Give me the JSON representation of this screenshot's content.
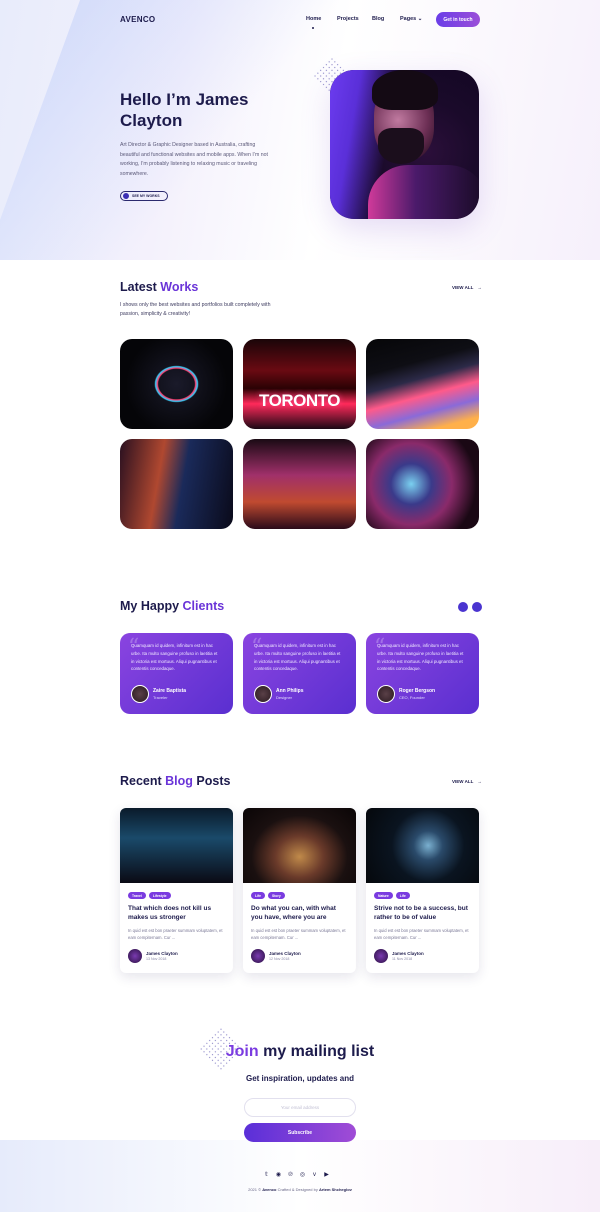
{
  "brand": "AVENCO",
  "nav": {
    "home": "Home",
    "projects": "Projects",
    "blog": "Blog",
    "pages": "Pages ⌄",
    "cta": "Get in touch"
  },
  "hero": {
    "title": "Hello I’m James Clayton",
    "text": "Art Director & Graphic Designer based in Australia, crafting beautiful and functional websites and mobile apps. When I’m not working, I’m probably listening to relaxing music or traveling somewhere.",
    "button": "SEE MY WORKS"
  },
  "works": {
    "title_a": "Latest ",
    "title_b": "Works",
    "view_all": "VIEW ALL",
    "subtitle": "I shows only the best websites and portfolios built completely with passion, simplicity & creativity!",
    "toronto_text": "TORONTO"
  },
  "clients": {
    "title_a": "My Happy ",
    "title_b": "Clients",
    "quote": "Quamquam id quidem, infinitum est in hac urbe. Ita multo sanguine profuso in laetitia et in victoria est mortuus. Aliqui pugnantibus et contentis concedaque.",
    "items": [
      {
        "name": "Zaire Baptista",
        "role": "Traveler"
      },
      {
        "name": "Ann Philips",
        "role": "Designer"
      },
      {
        "name": "Roger Bergson",
        "role": "CEO, Founder"
      }
    ]
  },
  "blog": {
    "title_a": "Recent ",
    "title_b": "Blog",
    "title_c": " Posts",
    "view_all": "VIEW ALL",
    "excerpt": "In quid est est bon praeter summam voluptatem, et eam cempiternam. Cur ...",
    "posts": [
      {
        "tags": [
          "Travel",
          "Lifestyle"
        ],
        "title": "That which does not kill us makes us stronger",
        "author": "James Clayton",
        "date": "13 Nov 2018"
      },
      {
        "tags": [
          "Life",
          "Story"
        ],
        "title": "Do what you can, with what you have, where you are",
        "author": "James Clayton",
        "date": "12 Nov 2018"
      },
      {
        "tags": [
          "Nature",
          "Life"
        ],
        "title": "Strive not to be a success, but rather to be of value",
        "author": "James Clayton",
        "date": "11 Nov 2018"
      }
    ]
  },
  "mailing": {
    "title_a": "Join",
    "title_b": " my mailing list",
    "subtitle": "Get inspiration, updates and",
    "placeholder": "Your email address",
    "button": "Subscribe"
  },
  "footer": {
    "social": [
      "twitter-icon",
      "github-icon",
      "pinterest-icon",
      "spotify-icon",
      "vimeo-icon",
      "youtube-icon"
    ],
    "social_glyphs": [
      "𝕥",
      "◉",
      "℗",
      "◎",
      "v",
      "▶"
    ],
    "copy_a": "2021 © ",
    "copy_brand": "Avenco",
    "copy_b": " Crafted & Designed by ",
    "copy_author": "Artem Shcheglov"
  }
}
